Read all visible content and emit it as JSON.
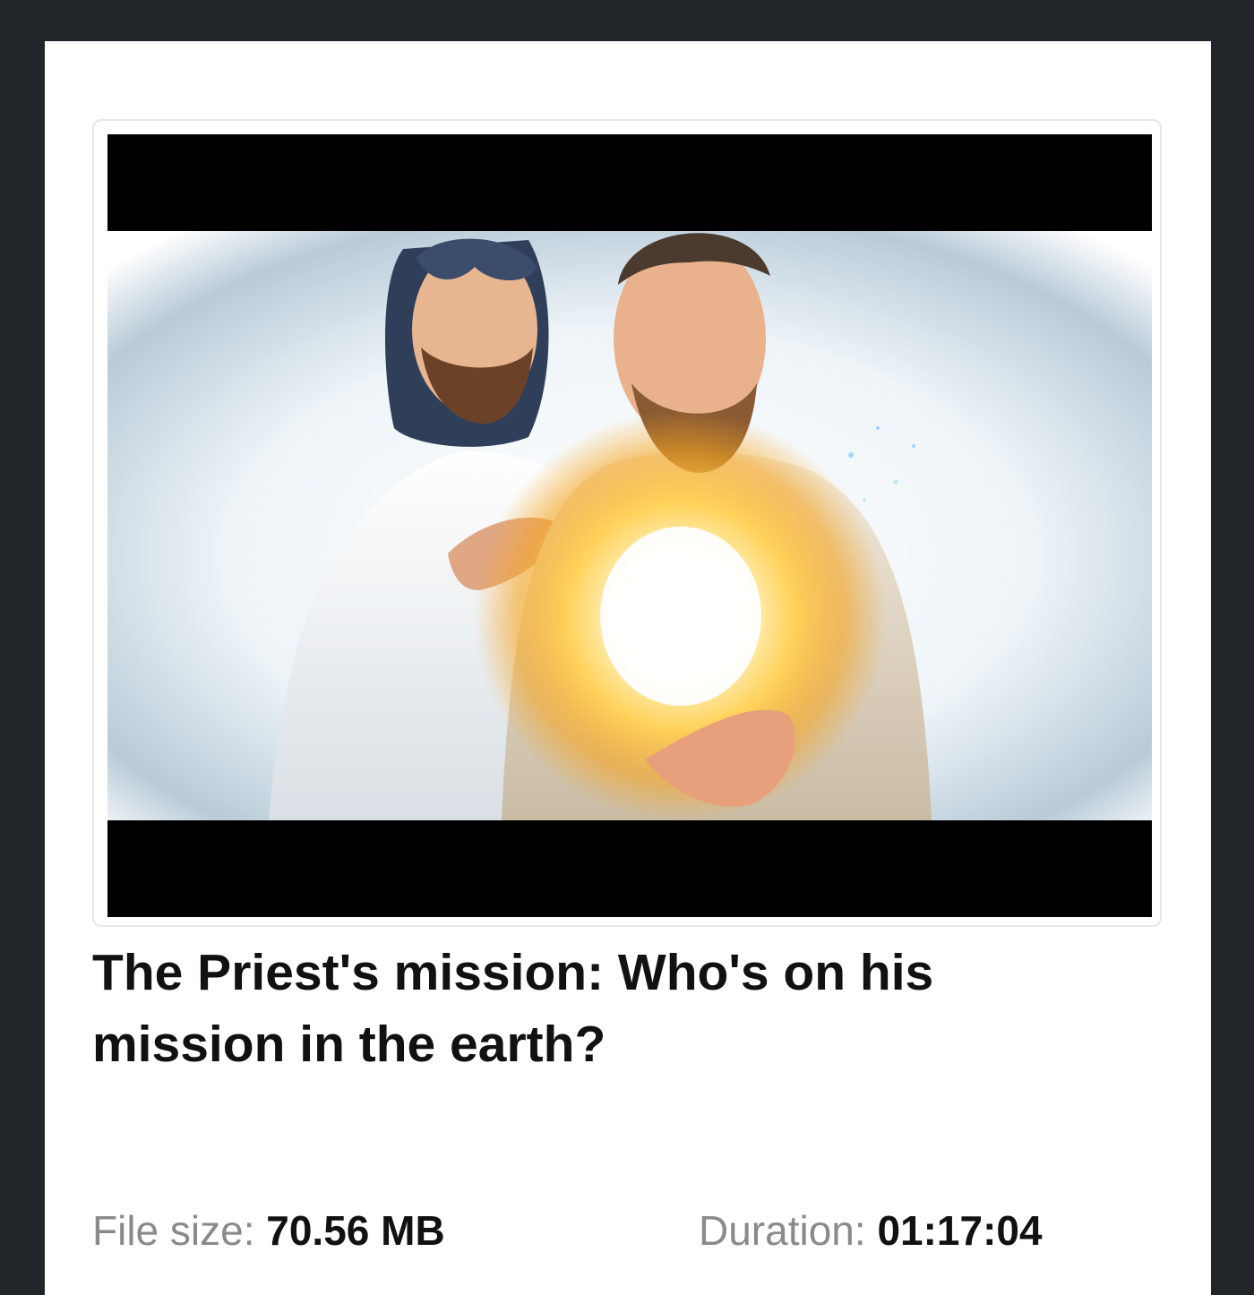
{
  "video": {
    "thumbnail_alt": "Illustration of Jesus with his hand on a smiling man's chest, a bright light glowing from the man's heart"
  },
  "title": "The Priest's mission: Who's on his mission in the earth?",
  "file_size": {
    "label": "File size:",
    "value": "70.56 MB"
  },
  "duration": {
    "label": "Duration:",
    "value": "01:17:04"
  }
}
